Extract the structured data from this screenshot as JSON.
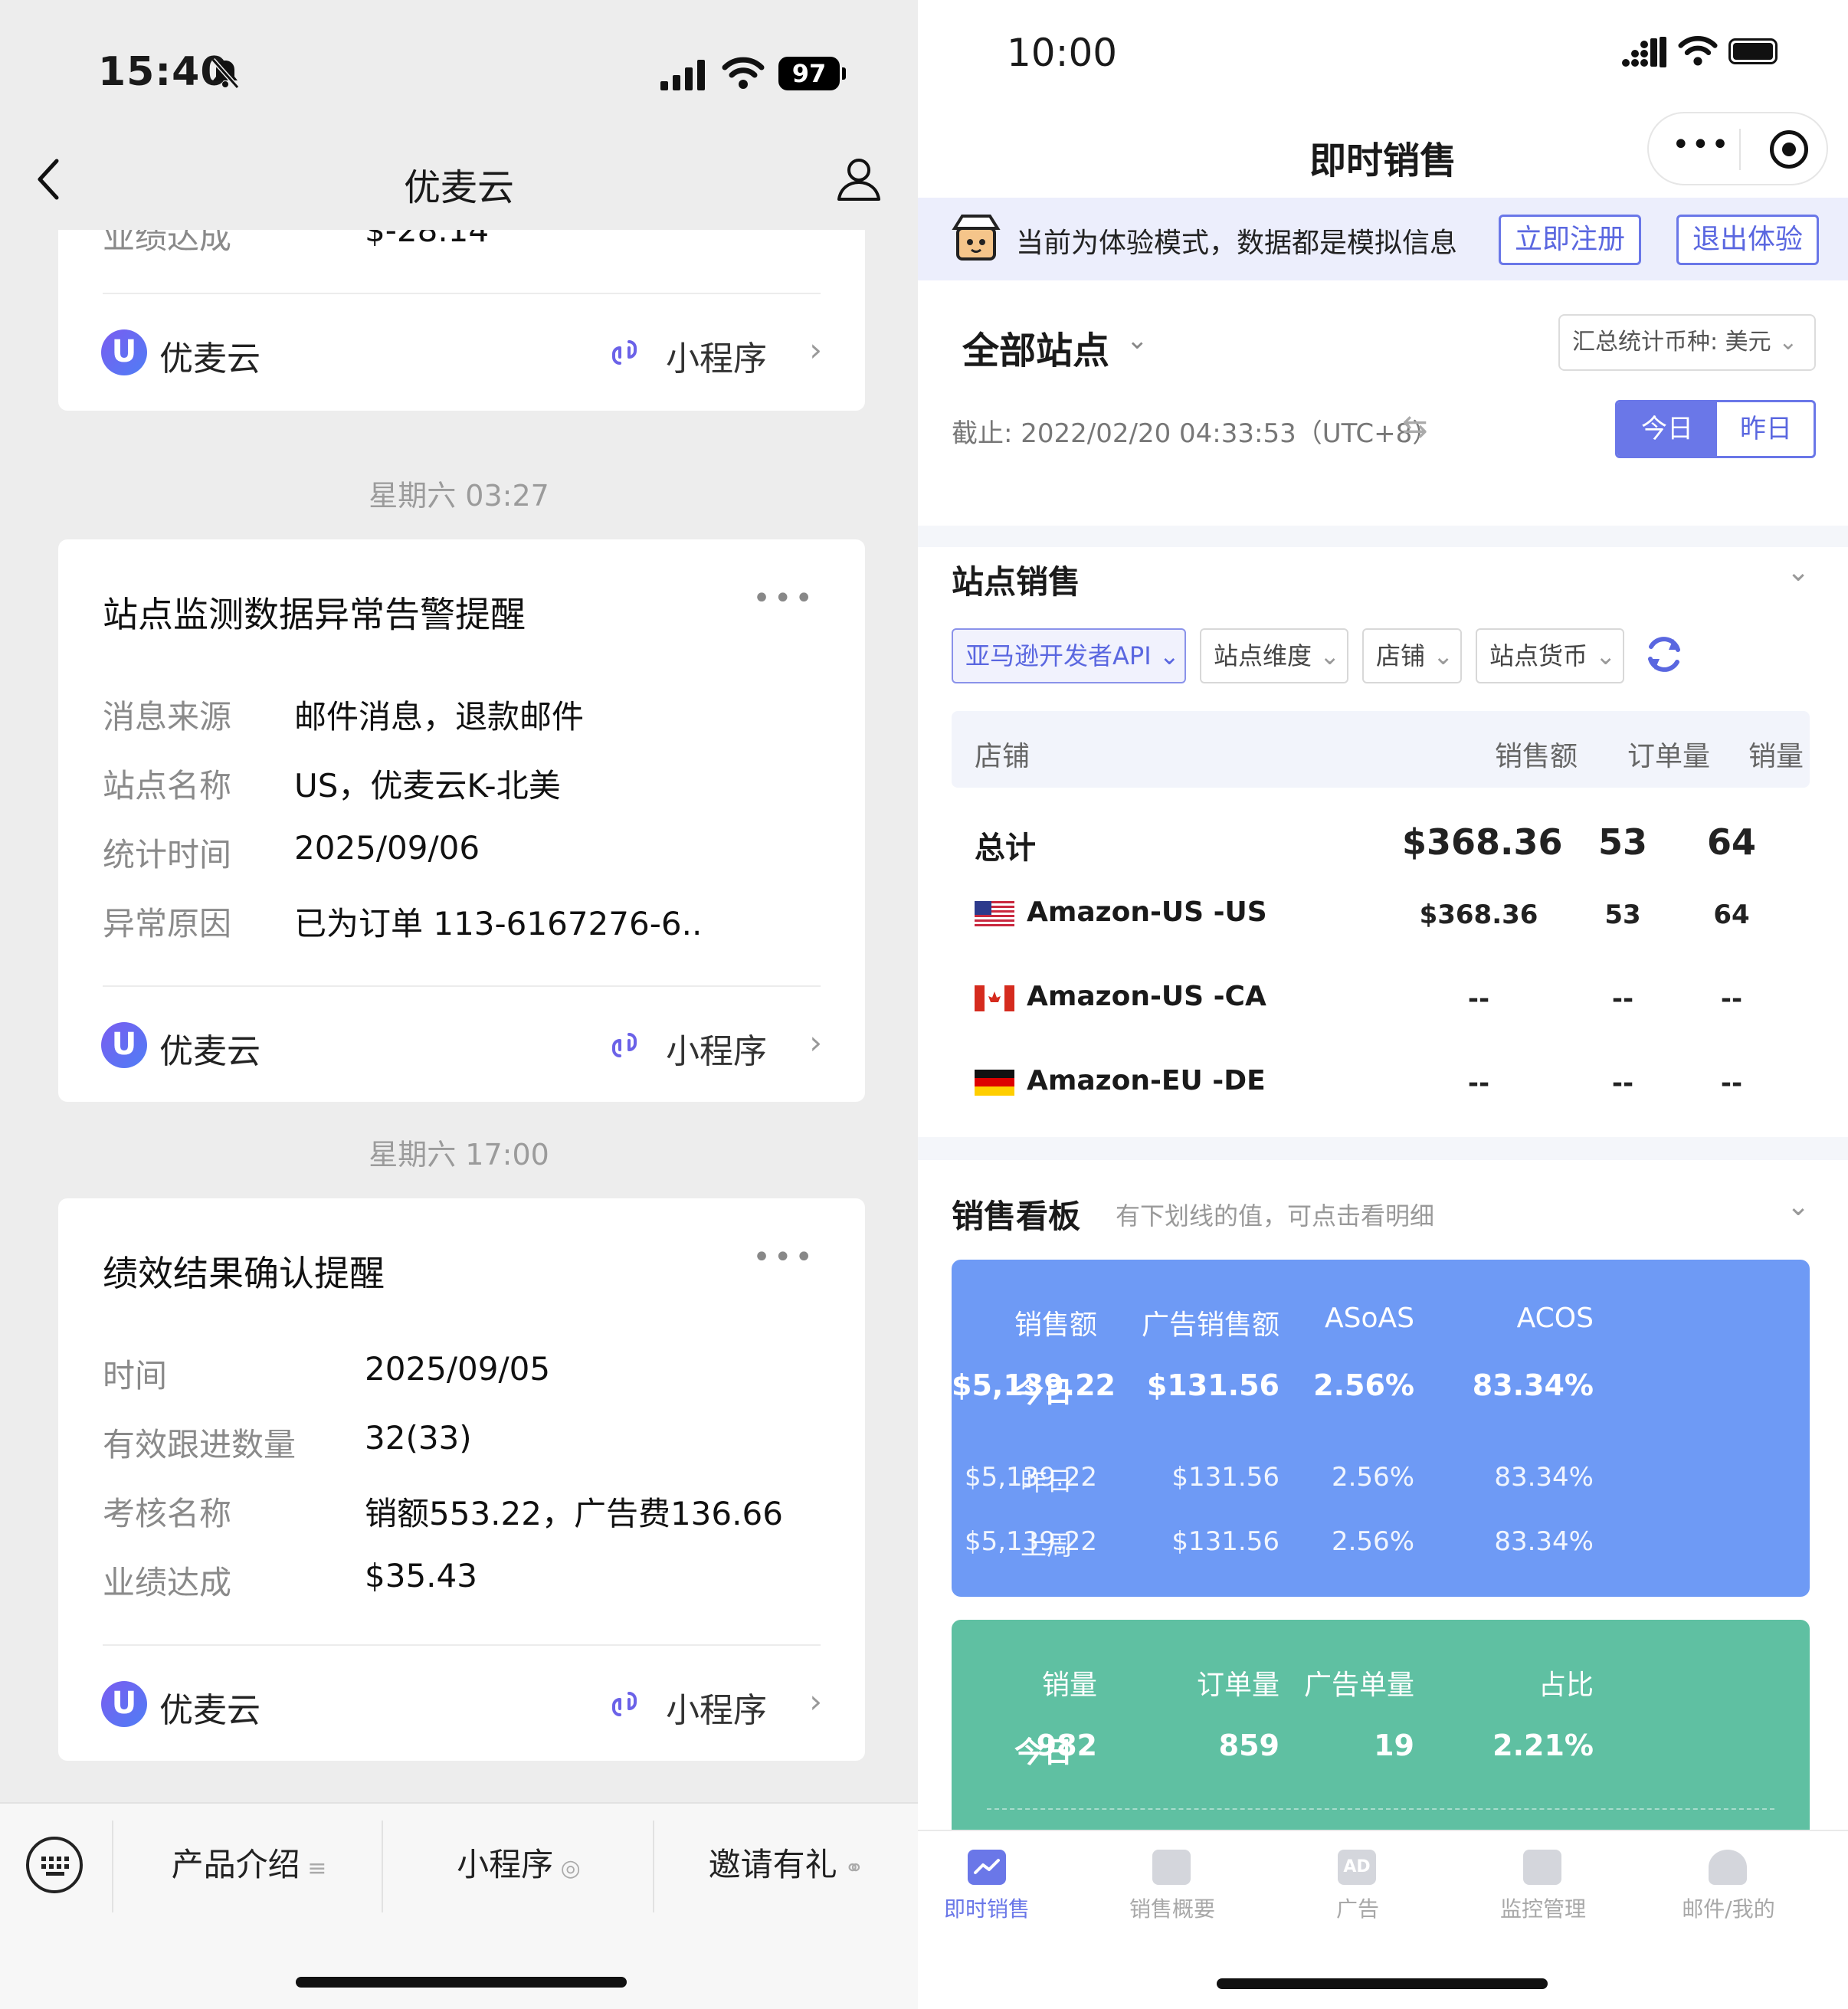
{
  "left": {
    "status": {
      "time": "15:40",
      "battery": "97"
    },
    "nav": {
      "title": "优麦云"
    },
    "card0": {
      "partial_label": "业绩达成",
      "partial_value": "$-28.14",
      "brand": "优麦云",
      "mini": "小程序"
    },
    "ts1": "星期六 03:27",
    "card1": {
      "title": "站点监测数据异常告警提醒",
      "rows": [
        {
          "label": "消息来源",
          "value": "邮件消息，退款邮件"
        },
        {
          "label": "站点名称",
          "value": "US，优麦云K-北美"
        },
        {
          "label": "统计时间",
          "value": "2025/09/06"
        },
        {
          "label": "异常原因",
          "value": "已为订单 113-6167276-6.."
        }
      ],
      "brand": "优麦云",
      "mini": "小程序"
    },
    "ts2": "星期六 17:00",
    "card2": {
      "title": "绩效结果确认提醒",
      "rows": [
        {
          "label": "时间",
          "value": "2025/09/05"
        },
        {
          "label": "有效跟进数量",
          "value": "32(33)"
        },
        {
          "label": "考核名称",
          "value": "销额553.22，广告费136.66"
        },
        {
          "label": "业绩达成",
          "value": "$35.43"
        }
      ],
      "brand": "优麦云",
      "mini": "小程序"
    },
    "menu": {
      "items": [
        "产品介绍",
        "小程序",
        "邀请有礼"
      ]
    },
    "brand_logo_letter": "U"
  },
  "right": {
    "status": {
      "time": "10:00"
    },
    "header": {
      "title": "即时销售"
    },
    "banner": {
      "text": "当前为体验模式，数据都是模拟信息",
      "register": "立即注册",
      "exit": "退出体验"
    },
    "filter": {
      "site": "全部站点",
      "currency": "汇总统计币种: 美元",
      "cutoff": "截止: 2022/02/20 04:33:53（UTC+8）",
      "today": "今日",
      "yesterday": "昨日"
    },
    "site_sales": {
      "title": "站点销售",
      "chips": [
        "亚马逊开发者API",
        "站点维度",
        "店铺",
        "站点货币"
      ],
      "headers": [
        "店铺",
        "销售额",
        "订单量",
        "销量"
      ],
      "total": {
        "label": "总计",
        "sales": "$368.36",
        "orders": "53",
        "qty": "64"
      },
      "rows": [
        {
          "shop": "Amazon-US -US",
          "sales": "$368.36",
          "orders": "53",
          "qty": "64",
          "flag": "us-flag-icon"
        },
        {
          "shop": "Amazon-US -CA",
          "sales": "--",
          "orders": "--",
          "qty": "--",
          "flag": "ca-flag-icon"
        },
        {
          "shop": "Amazon-EU -DE",
          "sales": "--",
          "orders": "--",
          "qty": "--",
          "flag": "de-flag-icon"
        }
      ]
    },
    "board": {
      "title": "销售看板",
      "hint": "有下划线的值，可点击看明细",
      "blue": {
        "color": "#6e9af5",
        "headers": [
          "销售额",
          "广告销售额",
          "ASoAS",
          "ACOS"
        ],
        "rows": [
          {
            "label": "今日",
            "values": [
              "$5,139.22",
              "$131.56",
              "2.56%",
              "83.34%"
            ]
          },
          {
            "label": "昨日",
            "values": [
              "$5,139.22",
              "$131.56",
              "2.56%",
              "83.34%"
            ]
          },
          {
            "label": "上周",
            "values": [
              "$5,139.22",
              "$131.56",
              "2.56%",
              "83.34%"
            ]
          }
        ]
      },
      "green": {
        "color": "#5fc0a2",
        "headers": [
          "销量",
          "订单量",
          "广告单量",
          "占比"
        ],
        "rows": [
          {
            "label": "今日",
            "values": [
              "982",
              "859",
              "19",
              "2.21%"
            ]
          }
        ]
      }
    },
    "tabs": [
      "即时销售",
      "销售概要",
      "广告",
      "监控管理",
      "邮件/我的"
    ],
    "accent": "#6a77e8"
  }
}
